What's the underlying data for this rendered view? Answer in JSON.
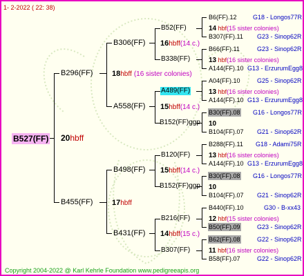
{
  "date_line": "1-  2-2022 ( 22: 38)",
  "root": {
    "name": "B527(FF)",
    "num": "20",
    "tag": "hbff"
  },
  "parents": [
    {
      "name": "B296(FF)",
      "num": "18",
      "tag": "hbff",
      "extra": "(16 sister colonies)"
    },
    {
      "name": "B455(FF)",
      "num": "17",
      "tag": "hbff"
    }
  ],
  "gen3": [
    {
      "name": "B306(FF)",
      "num": "16",
      "tag": "hbff",
      "extra": "(14 c.)"
    },
    {
      "name": "A558(FF)",
      "num": "15",
      "tag": "hbff",
      "extra": "(14 c.)"
    },
    {
      "name": "B498(FF)",
      "num": "15",
      "tag": "hbff",
      "extra": "(14 c.)"
    },
    {
      "name": "B431(FF)",
      "num": "14",
      "tag": "hbff",
      "extra": "(15 c.)"
    }
  ],
  "gen4": [
    {
      "name": "B52(FF)",
      "num": "14",
      "tag": "hbf",
      "extra": "(15 sister colonies)"
    },
    {
      "name": "B338(FF)",
      "num": "13",
      "tag": "hbf",
      "extra": "(16 sister colonies)"
    },
    {
      "name": "A489(FF)",
      "num": "13",
      "tag": "hbf",
      "extra": "(16 sister colonies)"
    },
    {
      "name": "B152(FF)ggp",
      "num": "10",
      "tag": "",
      "extra": ""
    },
    {
      "name": "B120(FF)",
      "num": "13",
      "tag": "hbf",
      "extra": "(16 sister colonies)"
    },
    {
      "name": "B152(FF)ggp",
      "num": "10",
      "tag": "",
      "extra": ""
    },
    {
      "name": "B216(FF)",
      "num": "12",
      "tag": "hbf",
      "extra": "(15 sister colonies)"
    },
    {
      "name": "B307(FF)",
      "num": "11",
      "tag": "hbf",
      "extra": "(16 sister colonies)"
    }
  ],
  "gen5": [
    {
      "name": "B6(FF).12",
      "src": "G18 - Longos77R"
    },
    {
      "name": "B307(FF).11",
      "src": "G23 - Sinop62R"
    },
    {
      "name": "B66(FF).11",
      "src": "G23 - Sinop62R"
    },
    {
      "name": "A144(FF).10",
      "src": "G13 - ErzurumEgg8"
    },
    {
      "name": "A04(FF).10",
      "src": "G25 - Sinop62R"
    },
    {
      "name": "A144(FF).10",
      "src": "G13 - ErzurumEgg8"
    },
    {
      "name": "B30(FF).08",
      "src": "G16 - Longos77R"
    },
    {
      "name": "B104(FF).07",
      "src": "G21 - Sinop62R"
    },
    {
      "name": "B288(FF).11",
      "src": "G18 - Adami75R"
    },
    {
      "name": "A144(FF).10",
      "src": "G13 - ErzurumEgg8"
    },
    {
      "name": "B30(FF).08",
      "src": "G16 - Longos77R"
    },
    {
      "name": "B104(FF).07",
      "src": "G21 - Sinop62R"
    },
    {
      "name": "B440(FF).10",
      "src": "G30 - B-xx43"
    },
    {
      "name": "B50(FF).09",
      "src": "G23 - Sinop62R"
    },
    {
      "name": "B62(FF).08",
      "src": "G22 - Sinop62R"
    },
    {
      "name": "B58(FF).07",
      "src": "G22 - Sinop62R"
    }
  ],
  "copyright": "Copyright 2004-2022 @ Karl Kehrle Foundation    www.pedigreeapis.org",
  "colors": {
    "frame": "#e800c0",
    "root_bg": "#f6b4f2",
    "cyan": "#33e5f0",
    "grey": "#a8a8a8",
    "red": "#c00000",
    "blue": "#0000c0",
    "green": "#18a018"
  }
}
